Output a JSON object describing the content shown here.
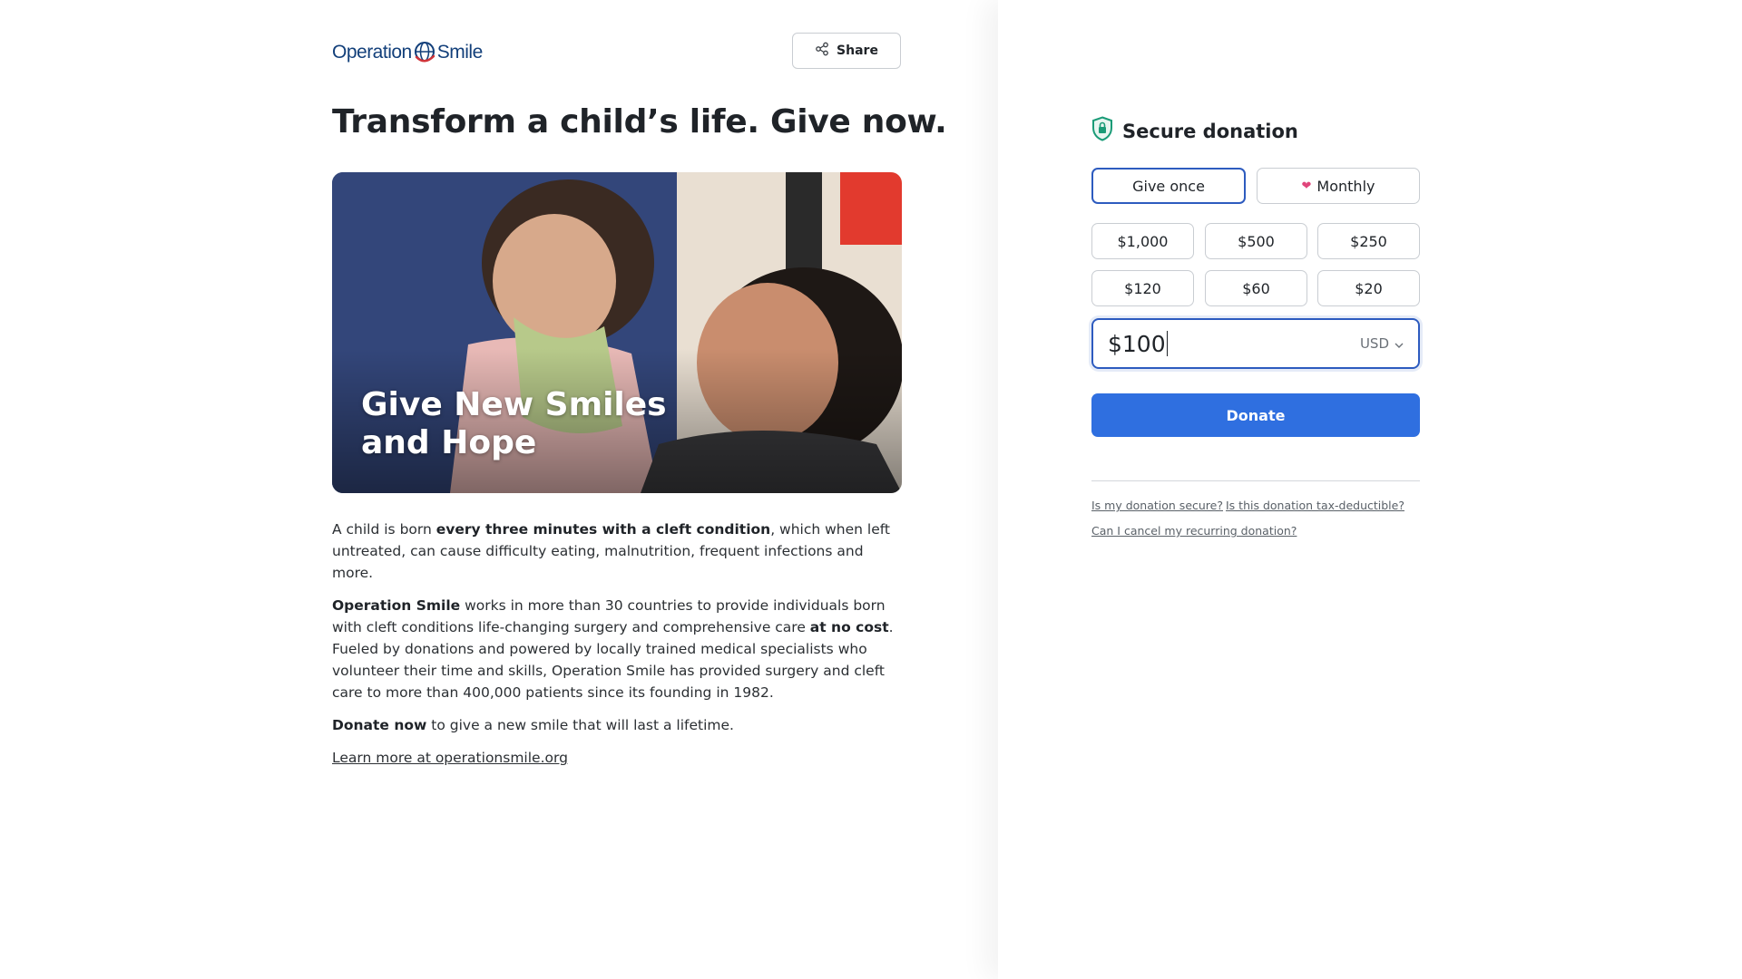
{
  "brand": {
    "logo_left": "Operation",
    "logo_right": "Smile"
  },
  "header": {
    "share_label": "Share"
  },
  "headline": "Transform a child’s life. Give now.",
  "hero": {
    "overlay_line1": "Give New Smiles",
    "overlay_line2": "and Hope"
  },
  "body": {
    "p1_a": "A child is born ",
    "p1_b": "every three minutes with a cleft condition",
    "p1_c": ", which when left untreated, can cause difficulty eating, malnutrition, frequent infections and more.",
    "p2_a": "Operation Smile",
    "p2_b": " works in more than 30 countries to provide individuals born with cleft conditions life-changing surgery and comprehensive care ",
    "p2_c": "at no cost",
    "p2_d": ". Fueled by donations and powered by locally trained medical specialists who volunteer their time and skills, Operation Smile has provided surgery and cleft care to more than 400,000 patients since its founding in 1982.",
    "p3_a": "Donate now",
    "p3_b": " to give a new smile that will last a lifetime.",
    "learn_more": "Learn more at operationsmile.org"
  },
  "donation": {
    "title": "Secure donation",
    "frequency": {
      "once_label": "Give once",
      "monthly_label": "Monthly",
      "selected": "once"
    },
    "amounts": [
      "$1,000",
      "$500",
      "$250",
      "$120",
      "$60",
      "$20"
    ],
    "custom_amount": "$100",
    "currency": "USD",
    "donate_label": "Donate",
    "faq": {
      "secure": "Is my donation secure?",
      "tax": "Is this donation tax-deductible?",
      "cancel": "Can I cancel my recurring donation?"
    }
  },
  "colors": {
    "accent_blue": "#2f6fe0",
    "selected_border": "#2d5bbf",
    "heart_pink": "#e0457b",
    "shield_green": "#1a9b77",
    "logo_navy": "#123f7a"
  },
  "icons": [
    "share-icon",
    "shield-lock-icon",
    "heart-icon",
    "chevron-down-icon",
    "globe-icon"
  ]
}
